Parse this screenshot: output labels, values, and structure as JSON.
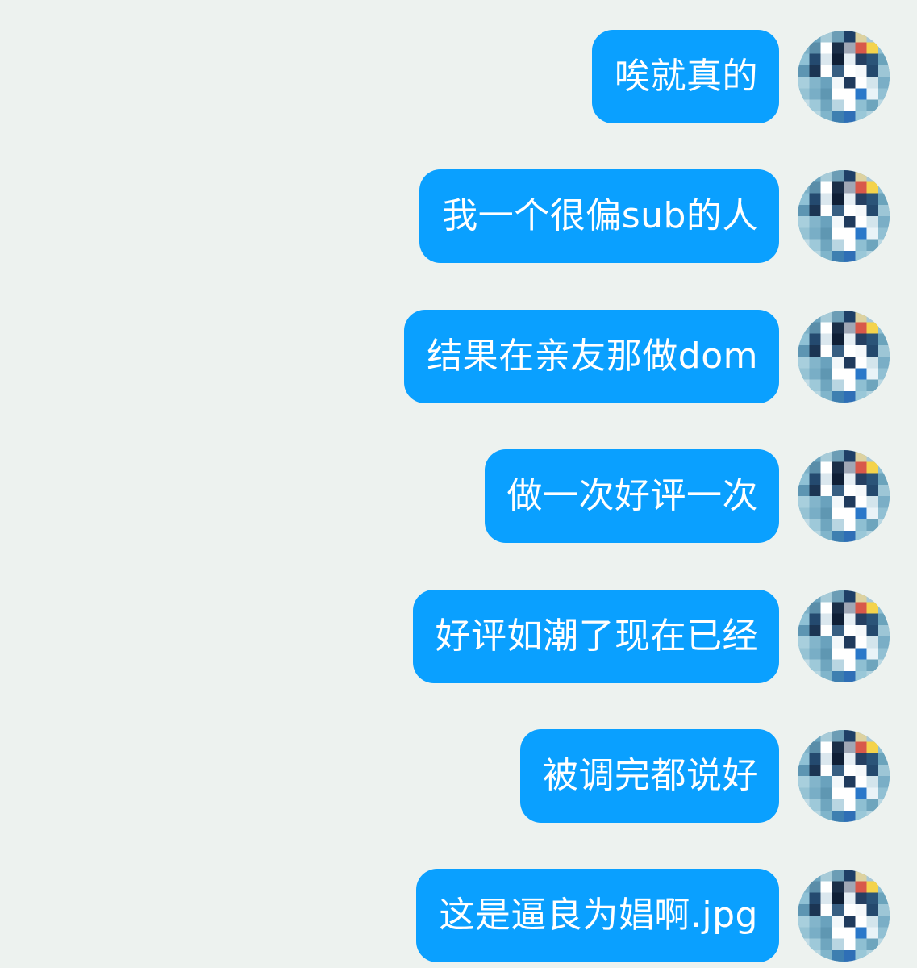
{
  "chat": {
    "messages": [
      {
        "text": "唉就真的"
      },
      {
        "text": "我一个很偏sub的人"
      },
      {
        "text": "结果在亲友那做dom"
      },
      {
        "text": "做一次好评一次"
      },
      {
        "text": "好评如潮了现在已经"
      },
      {
        "text": "被调完都说好"
      },
      {
        "text": "这是逼良为娼啊.jpg"
      }
    ]
  },
  "colors": {
    "background": "#edf2ef",
    "bubble": "#0aa0ff",
    "bubble_text": "#ffffff"
  },
  "icons": {
    "avatar": "pixelated-avatar-icon"
  }
}
